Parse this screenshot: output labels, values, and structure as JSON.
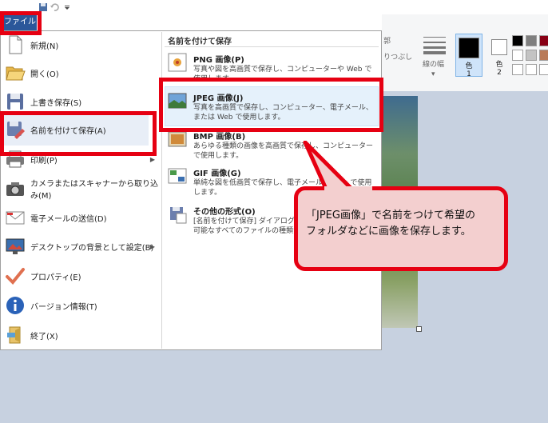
{
  "file_tab": "ファイル",
  "menu": {
    "items": [
      {
        "label": "新規(N)",
        "icon": "new-file-icon"
      },
      {
        "label": "開く(O)",
        "icon": "open-folder-icon"
      },
      {
        "label": "上書き保存(S)",
        "icon": "save-icon"
      },
      {
        "label": "名前を付けて保存(A)",
        "icon": "save-as-icon"
      },
      {
        "label": "印刷(P)",
        "icon": "print-icon"
      },
      {
        "label": "カメラまたはスキャナーから取り込み(M)",
        "icon": "camera-scanner-icon"
      },
      {
        "label": "電子メールの送信(D)",
        "icon": "email-icon"
      },
      {
        "label": "デスクトップの背景として設定(B)",
        "icon": "desktop-background-icon"
      },
      {
        "label": "プロパティ(E)",
        "icon": "properties-checkmark-icon"
      },
      {
        "label": "バージョン情報(T)",
        "icon": "info-icon"
      },
      {
        "label": "終了(X)",
        "icon": "exit-icon"
      }
    ]
  },
  "submenu": {
    "title": "名前を付けて保存",
    "items": [
      {
        "title": "PNG 画像(P)",
        "desc": "写真や図を高画質で保存し、コンピューターや Web で使用します。"
      },
      {
        "title": "JPEG 画像(J)",
        "desc": "写真を高画質で保存し、コンピューター、電子メール、または Web で使用します。"
      },
      {
        "title": "BMP 画像(B)",
        "desc": "あらゆる種類の画像を高画質で保存し、コンピューターで使用します。"
      },
      {
        "title": "GIF 画像(G)",
        "desc": "単純な図を低画質で保存し、電子メールや Web で使用します。"
      },
      {
        "title": "その他の形式(O)",
        "desc": "[名前を付けて保存] ダイアログ ボックスを開き、使用可能なすべてのファイルの種類から選択します。"
      }
    ]
  },
  "callout": {
    "line1": "「JPEG画像」で名前をつけて希望の",
    "line2": "フォルダなどに画像を保存します。"
  },
  "ribbon": {
    "partial_label_1": "郭",
    "partial_label_2": "りつぶし",
    "line_width": "線の幅",
    "color1": "色",
    "color1_num": "1",
    "color2": "色",
    "color2_num": "2"
  },
  "colors": {
    "file_tab": "#2b579a",
    "highlight_red": "#e60012",
    "callout_fill": "#f3cfcf"
  }
}
